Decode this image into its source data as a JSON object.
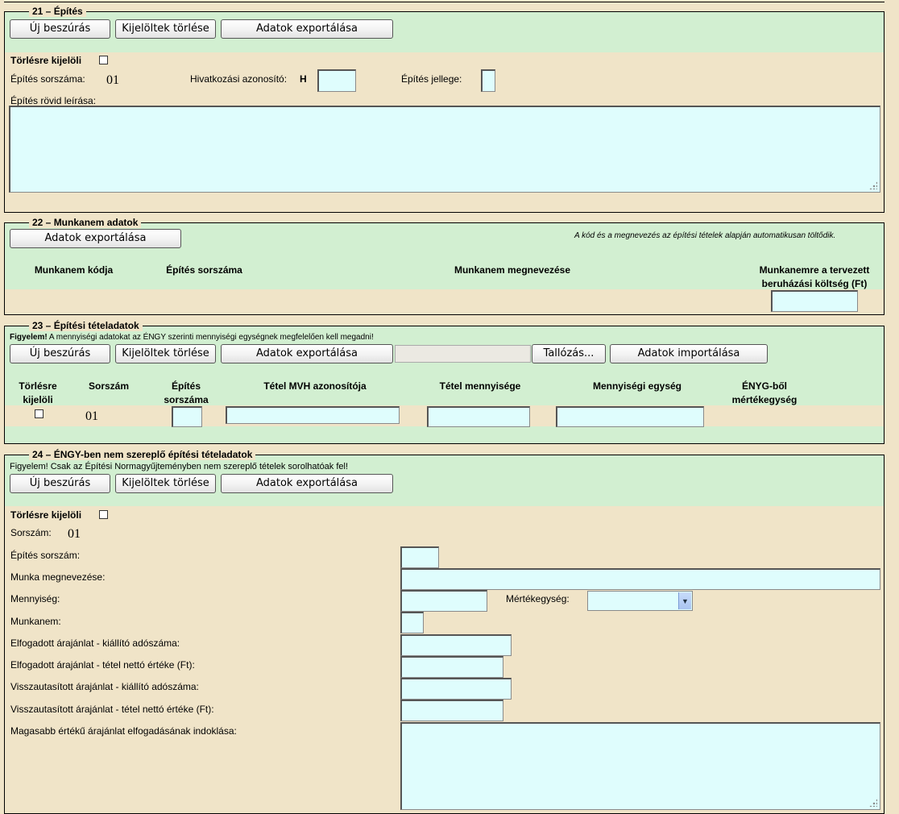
{
  "s21": {
    "legend": "21 – Építés",
    "buttons": {
      "insert": "Új beszúrás",
      "delete": "Kijelöltek törlése",
      "export": "Adatok exportálása"
    },
    "mark_delete": "Törlésre kijelöli",
    "seq_label": "Építés sorszáma:",
    "seq_value": "01",
    "ref_label": "Hivatkozási azonosító:",
    "ref_prefix": "H",
    "type_label": "Építés jellege:",
    "desc_label": "Építés rövid leírása:"
  },
  "s22": {
    "legend": "22 – Munkanem adatok",
    "export": "Adatok exportálása",
    "note": "A kód és a megnevezés az építési tételek alapján automatikusan töltődik.",
    "columns": [
      "Munkanem kódja",
      "Építés sorszáma",
      "Munkanem megnevezése",
      "Munkanemre a tervezett beruházási költség (Ft)"
    ]
  },
  "s23": {
    "legend": "23 – Építési tételadatok",
    "warning_bold": "Figyelem!",
    "warning_text": " A mennyiségi adatokat az ÉNGY szerinti mennyiségi egységnek megfelelően kell megadni!",
    "buttons": {
      "insert": "Új beszúrás",
      "delete": "Kijelöltek törlése",
      "export": "Adatok exportálása",
      "browse": "Tallózás...",
      "import": "Adatok importálása"
    },
    "columns": [
      "Törlésre kijelöli",
      "Sorszám",
      "Építés sorszáma",
      "Tétel MVH azonosítója",
      "Tétel mennyisége",
      "Mennyiségi egység",
      "ÉNYG-ből mértékegység"
    ],
    "row_seq": "01"
  },
  "s24": {
    "legend": "24 – ÉNGY-ben nem szereplő építési tételadatok",
    "warning": "Figyelem! Csak az Építési Normagyűjteményben nem szereplő tételek sorolhatóak fel!",
    "buttons": {
      "insert": "Új beszúrás",
      "delete": "Kijelöltek törlése",
      "export": "Adatok exportálása"
    },
    "mark_delete": "Törlésre kijelöli",
    "seq_label": "Sorszám:",
    "seq_value": "01",
    "labels": {
      "build_seq": "Építés sorszám:",
      "work_name": "Munka megnevezése:",
      "quantity": "Mennyiség:",
      "unit": "Mértékegység:",
      "work_type": "Munkanem:",
      "acc_tax": "Elfogadott árajánlat - kiállító adószáma:",
      "acc_net": "Elfogadott árajánlat - tétel nettó értéke (Ft):",
      "rej_tax": "Visszautasított árajánlat - kiállító adószáma:",
      "rej_net": "Visszautasított árajánlat - tétel nettó értéke (Ft):",
      "justify": "Magasabb értékű árajánlat elfogadásának indoklása:"
    }
  },
  "colors": {
    "green_band": "#d2efd1",
    "beige_band": "#f0e4c8",
    "input_bg": "#dffdfd"
  },
  "icons": {
    "checkbox": "checkbox-icon",
    "dropdown": "chevron-down-icon",
    "resize": "resize-grip-icon"
  }
}
